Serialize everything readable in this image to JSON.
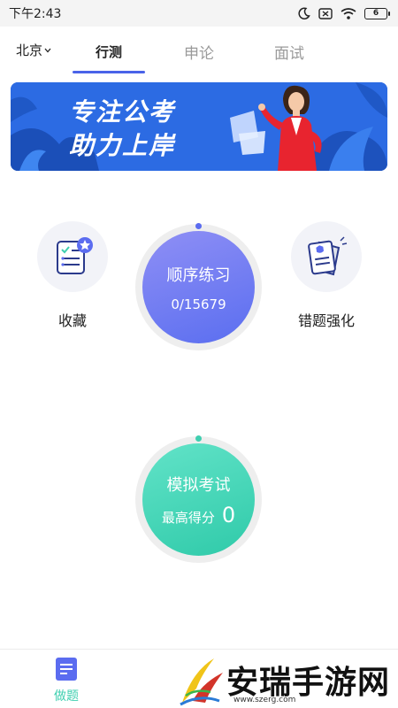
{
  "status_bar": {
    "time": "下午2:43",
    "battery": "6"
  },
  "header": {
    "city": "北京",
    "tabs": [
      {
        "label": "行测",
        "active": true
      },
      {
        "label": "申论",
        "active": false
      },
      {
        "label": "面试",
        "active": false
      }
    ],
    "accent_color": "#4a63e8"
  },
  "banner": {
    "line1": "专注公考",
    "line2": "助力上岸"
  },
  "practice": {
    "favorites_label": "收藏",
    "mistakes_label": "错题强化",
    "sequential": {
      "title": "顺序练习",
      "progress_text": "0/15679",
      "color": "#6f7cf2"
    },
    "mock_exam": {
      "title": "模拟考试",
      "best_label": "最高得分",
      "best_score": "0",
      "color": "#3fd6bb"
    }
  },
  "bottom_nav": {
    "items": [
      {
        "label": "做题",
        "icon": "document-icon",
        "active": true,
        "color": "#3fcfb0"
      }
    ]
  },
  "watermark": {
    "text": "安瑞手游网",
    "url": "www.szerg.com"
  }
}
